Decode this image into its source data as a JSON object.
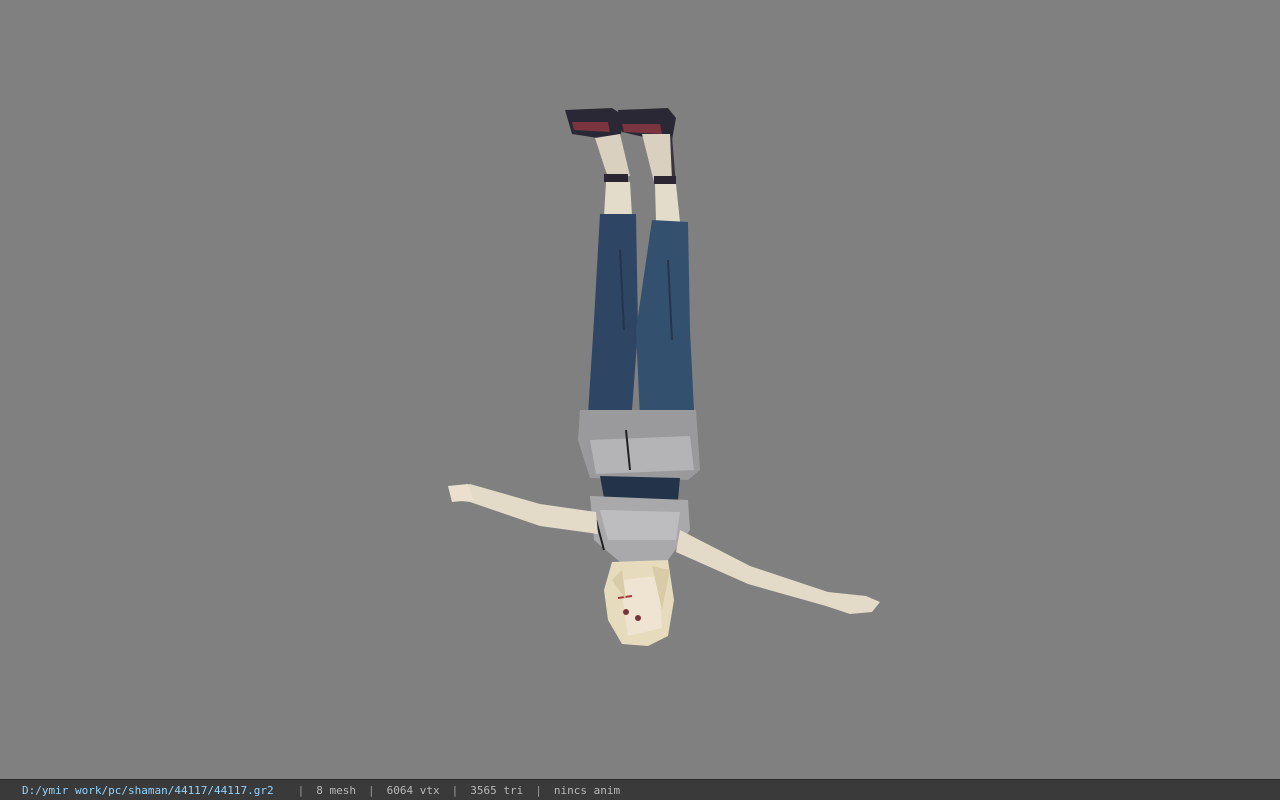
{
  "viewer": {
    "background_color": "#808080",
    "model_name": "upside-down character model (shaman)"
  },
  "status_bar": {
    "file_path": "D:/ymir work/pc/shaman/44117/44117.gr2",
    "separator": "|",
    "mesh_count": "8 mesh",
    "vertex_count": "6064 vtx",
    "triangle_count": "3565 tri",
    "anim_status": "nincs anim"
  }
}
